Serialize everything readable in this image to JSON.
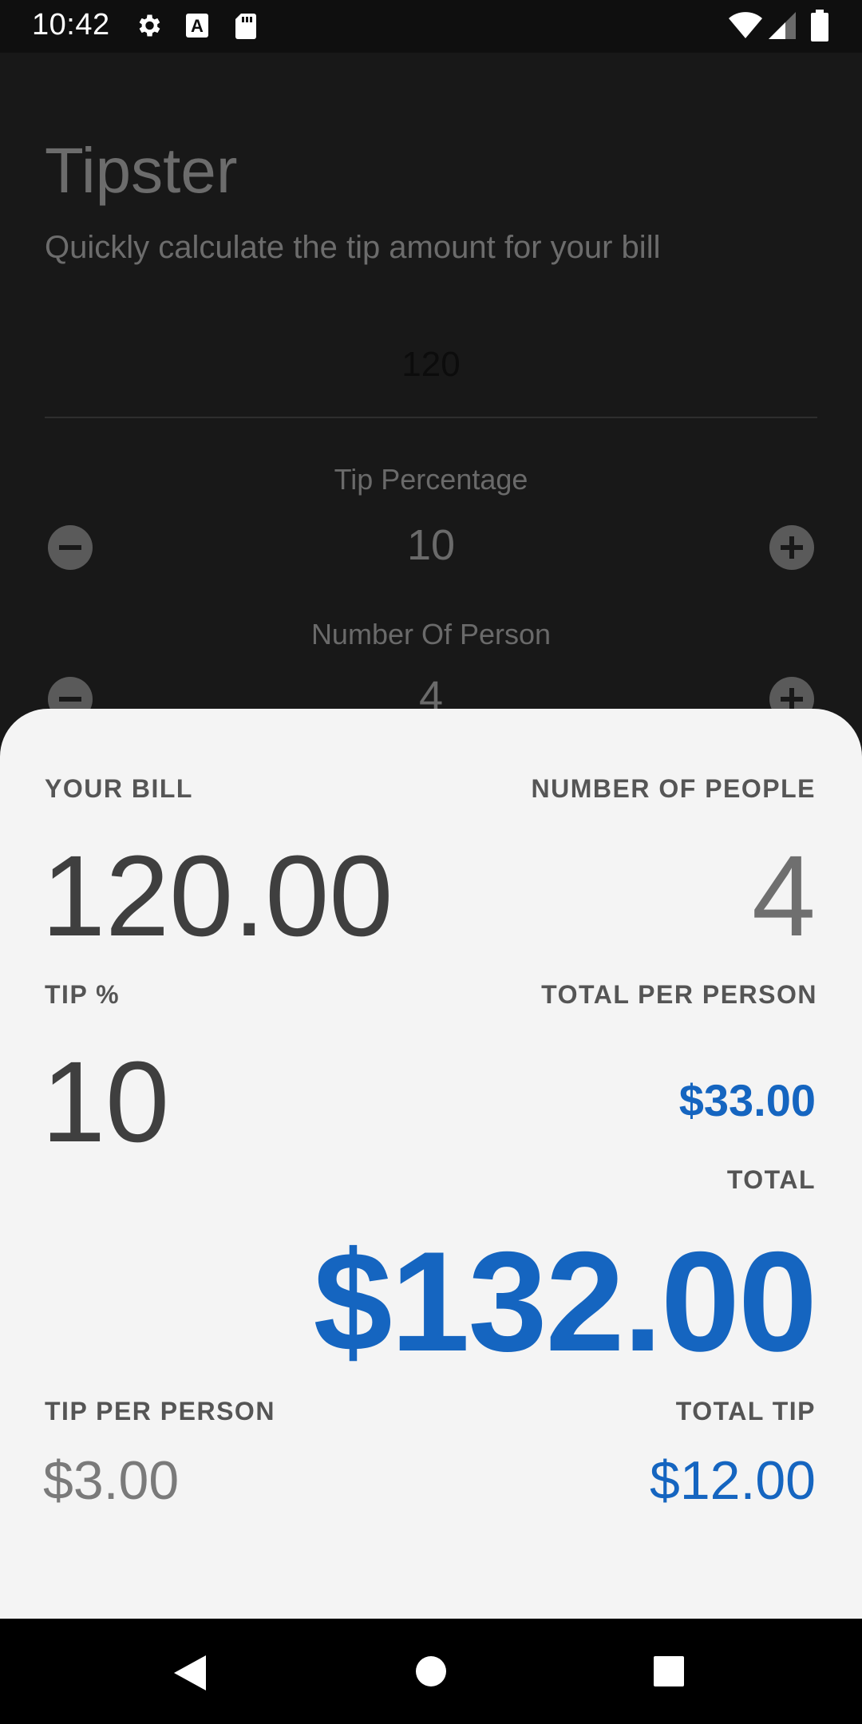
{
  "status_bar": {
    "time": "10:42",
    "icons": [
      "gear-icon",
      "a-icon",
      "sd-card-icon",
      "wifi-icon",
      "signal-icon",
      "battery-icon"
    ]
  },
  "app": {
    "title": "Tipster",
    "subtitle": "Quickly calculate the tip amount for your bill",
    "bill_value": "120",
    "tip_label": "Tip Percentage",
    "tip_value": "10",
    "people_label": "Number Of Person",
    "people_value": "4"
  },
  "sheet": {
    "your_bill_label": "YOUR BILL",
    "your_bill_value": "120.00",
    "people_label": "NUMBER OF PEOPLE",
    "people_value": "4",
    "tip_pct_label": "TIP %",
    "tip_pct_value": "10",
    "total_per_person_label": "TOTAL PER PERSON",
    "total_per_person_value": "$33.00",
    "total_label": "TOTAL",
    "total_value": "$132.00",
    "tip_per_person_label": "TIP PER PERSON",
    "tip_per_person_value": "$3.00",
    "total_tip_label": "TOTAL TIP",
    "total_tip_value": "$12.00"
  },
  "colors": {
    "accent_blue": "#1565c0",
    "sheet_bg": "#f4f4f4",
    "dark_bg": "#181818"
  },
  "nav_bar": {
    "icons": [
      "back-icon",
      "home-icon",
      "recents-icon"
    ]
  }
}
